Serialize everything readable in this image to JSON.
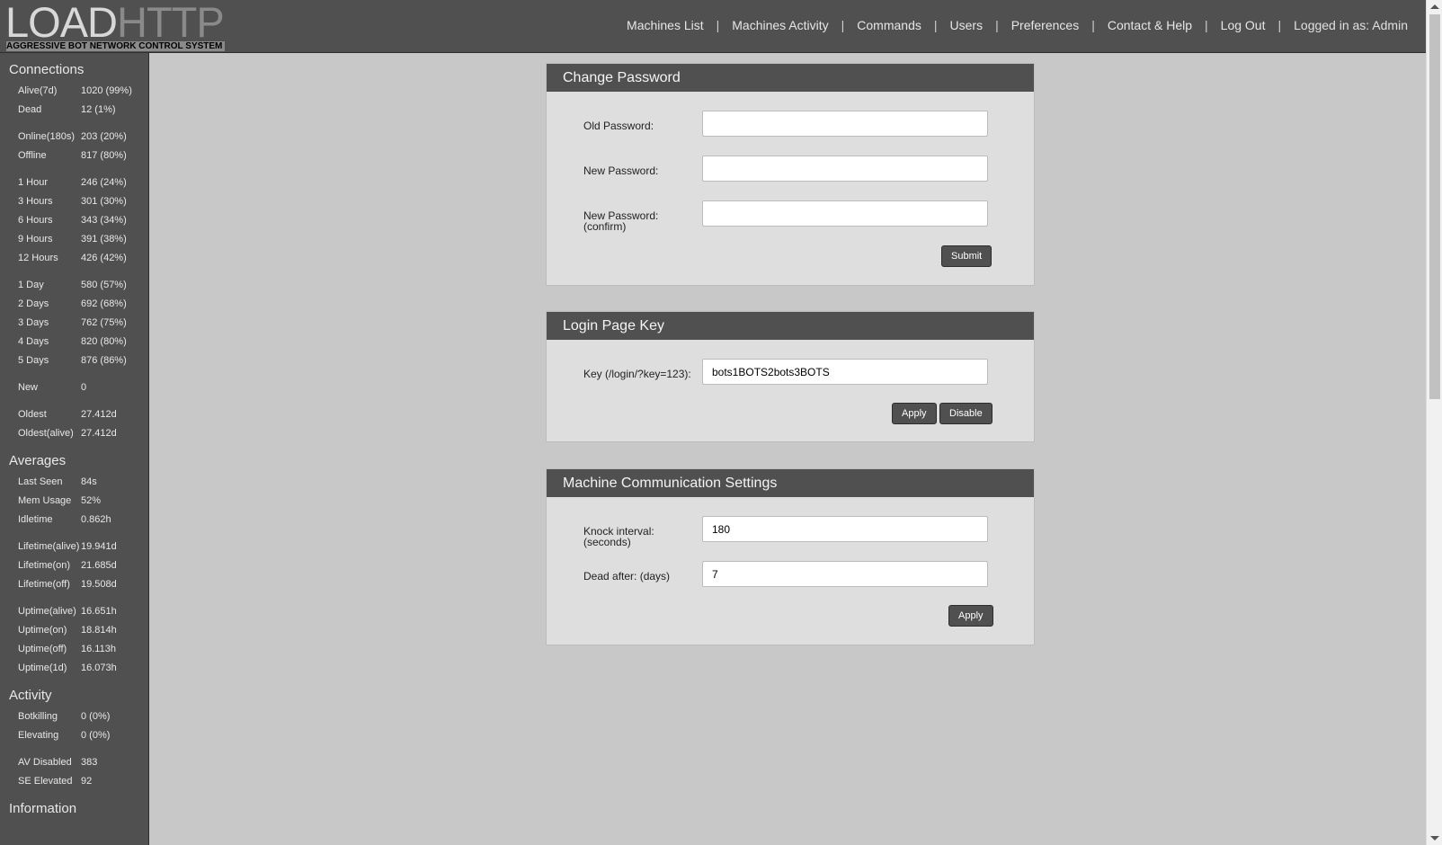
{
  "header": {
    "logo_load": "LOAD",
    "logo_http": "HTTP",
    "logo_subtitle": "AGGRESSIVE BOT NETWORK CONTROL SYSTEM",
    "nav": [
      {
        "label": "Machines List"
      },
      {
        "label": "Machines Activity"
      },
      {
        "label": "Commands"
      },
      {
        "label": "Users"
      },
      {
        "label": "Preferences"
      },
      {
        "label": "Contact & Help"
      },
      {
        "label": "Log Out"
      }
    ],
    "logged_in": "Logged in as: Admin",
    "separator": "|"
  },
  "sidebar": {
    "connections_title": "Connections",
    "connections": [
      [
        {
          "k": "Alive(7d)",
          "v": "1020 (99%)"
        },
        {
          "k": "Dead",
          "v": "12 (1%)"
        }
      ],
      [
        {
          "k": "Online(180s)",
          "v": "203 (20%)"
        },
        {
          "k": "Offline",
          "v": "817 (80%)"
        }
      ],
      [
        {
          "k": "1 Hour",
          "v": "246 (24%)"
        },
        {
          "k": "3 Hours",
          "v": "301 (30%)"
        },
        {
          "k": "6 Hours",
          "v": "343 (34%)"
        },
        {
          "k": "9 Hours",
          "v": "391 (38%)"
        },
        {
          "k": "12 Hours",
          "v": "426 (42%)"
        }
      ],
      [
        {
          "k": "1 Day",
          "v": "580 (57%)"
        },
        {
          "k": "2 Days",
          "v": "692 (68%)"
        },
        {
          "k": "3 Days",
          "v": "762 (75%)"
        },
        {
          "k": "4 Days",
          "v": "820 (80%)"
        },
        {
          "k": "5 Days",
          "v": "876 (86%)"
        }
      ],
      [
        {
          "k": "New",
          "v": "0"
        }
      ],
      [
        {
          "k": "Oldest",
          "v": "27.412d"
        },
        {
          "k": "Oldest(alive)",
          "v": "27.412d"
        }
      ]
    ],
    "averages_title": "Averages",
    "averages": [
      [
        {
          "k": "Last Seen",
          "v": "84s"
        },
        {
          "k": "Mem Usage",
          "v": "52%"
        },
        {
          "k": "Idletime",
          "v": "0.862h"
        }
      ],
      [
        {
          "k": "Lifetime(alive)",
          "v": "19.941d"
        },
        {
          "k": "Lifetime(on)",
          "v": "21.685d"
        },
        {
          "k": "Lifetime(off)",
          "v": "19.508d"
        }
      ],
      [
        {
          "k": "Uptime(alive)",
          "v": "16.651h"
        },
        {
          "k": "Uptime(on)",
          "v": "18.814h"
        },
        {
          "k": "Uptime(off)",
          "v": "16.113h"
        },
        {
          "k": "Uptime(1d)",
          "v": "16.073h"
        }
      ]
    ],
    "activity_title": "Activity",
    "activity": [
      [
        {
          "k": "Botkilling",
          "v": "0 (0%)"
        },
        {
          "k": "Elevating",
          "v": "0 (0%)"
        }
      ],
      [
        {
          "k": "AV Disabled",
          "v": "383"
        },
        {
          "k": "SE Elevated",
          "v": "92"
        }
      ]
    ],
    "information_title": "Information"
  },
  "change_password": {
    "title": "Change Password",
    "old_label": "Old Password:",
    "new_label": "New Password:",
    "confirm_label_1": "New Password:",
    "confirm_label_2": "(confirm)",
    "old_value": "",
    "new_value": "",
    "confirm_value": "",
    "submit": "Submit"
  },
  "login_key": {
    "title": "Login Page Key",
    "key_label": "Key (/login/?key=123):",
    "key_value": "bots1BOTS2bots3BOTS",
    "apply": "Apply",
    "disable": "Disable"
  },
  "comm": {
    "title": "Machine Communication Settings",
    "knock_label_1": "Knock interval:",
    "knock_label_2": "(seconds)",
    "knock_value": "180",
    "dead_label": "Dead after: (days)",
    "dead_value": "7",
    "apply": "Apply"
  },
  "colors": {
    "chrome": "#505050",
    "background": "#c8c8c8",
    "panel": "#dedede"
  }
}
